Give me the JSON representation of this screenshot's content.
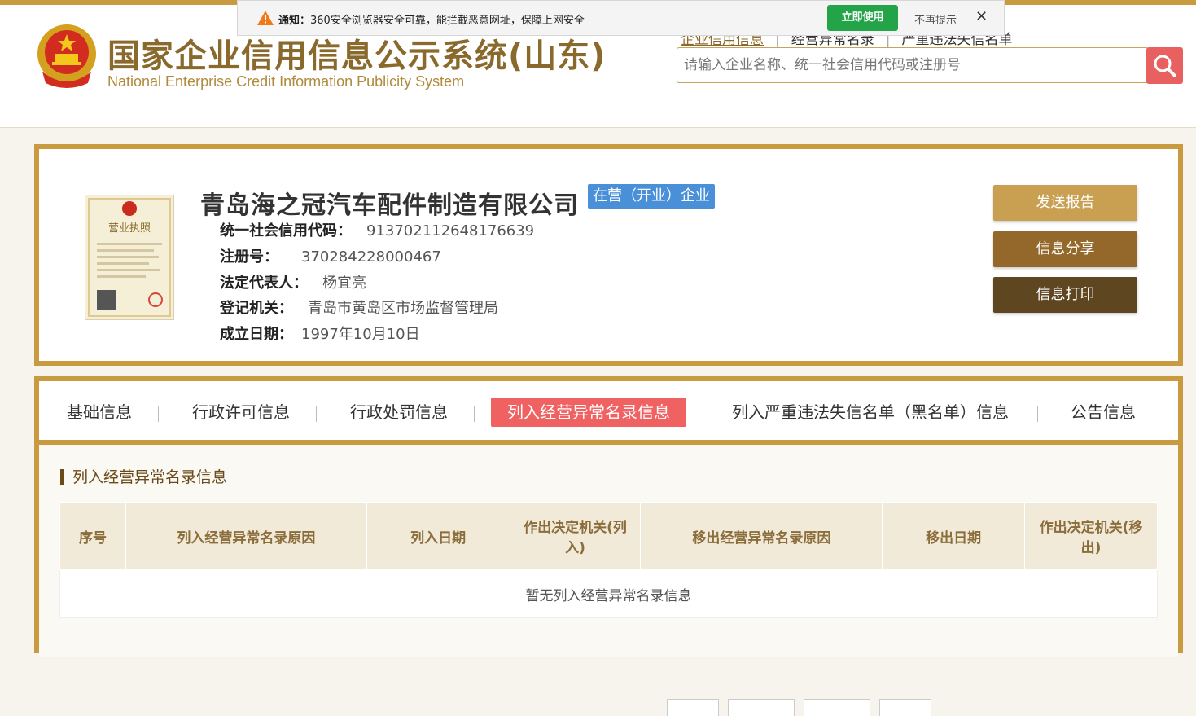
{
  "header": {
    "logo_cn": "国家企业信用信息公示系统(山东)",
    "logo_en": "National Enterprise Credit Information Publicity System",
    "links": [
      "企业信用信息",
      "经营异常名录",
      "严重违法失信名单"
    ],
    "search_placeholder": "请输入企业名称、统一社会信用代码或注册号"
  },
  "notification": {
    "prefix": "通知：",
    "text": "360安全浏览器安全可靠，能拦截恶意网址，保障上网安全",
    "use_label": "立即使用",
    "dismiss_label": "不再提示",
    "close": "✕"
  },
  "company": {
    "name": "青岛海之冠汽车配件制造有限公司",
    "status": "在营（开业）企业",
    "license_caption": "营业执照",
    "fields": [
      {
        "label": "统一社会信用代码：",
        "value": "913702112648176639"
      },
      {
        "label": "注册号：",
        "value": "370284228000467"
      },
      {
        "label": "法定代表人：",
        "value": "杨宜亮"
      },
      {
        "label": "登记机关：",
        "value": "青岛市黄岛区市场监督管理局"
      },
      {
        "label": "成立日期：",
        "value": "1997年10月10日"
      }
    ],
    "actions": [
      "发送报告",
      "信息分享",
      "信息打印"
    ]
  },
  "tabs": [
    "基础信息",
    "行政许可信息",
    "行政处罚信息",
    "列入经营异常名录信息",
    "列入严重违法失信名单（黑名单）信息",
    "公告信息"
  ],
  "section": {
    "title": "列入经营异常名录信息",
    "columns": [
      "序号",
      "列入经营异常名录原因",
      "列入日期",
      "作出决定机关(列入)",
      "移出经营异常名录原因",
      "移出日期",
      "作出决定机关(移出)"
    ],
    "empty_text": "暂无列入经营异常名录信息"
  },
  "colors": {
    "gold": "#c99a3f",
    "btn_send": "#c9a052",
    "btn_share": "#94682a",
    "btn_print": "#5e4620",
    "active_tab": "#f06262",
    "status": "#4a90d9"
  }
}
